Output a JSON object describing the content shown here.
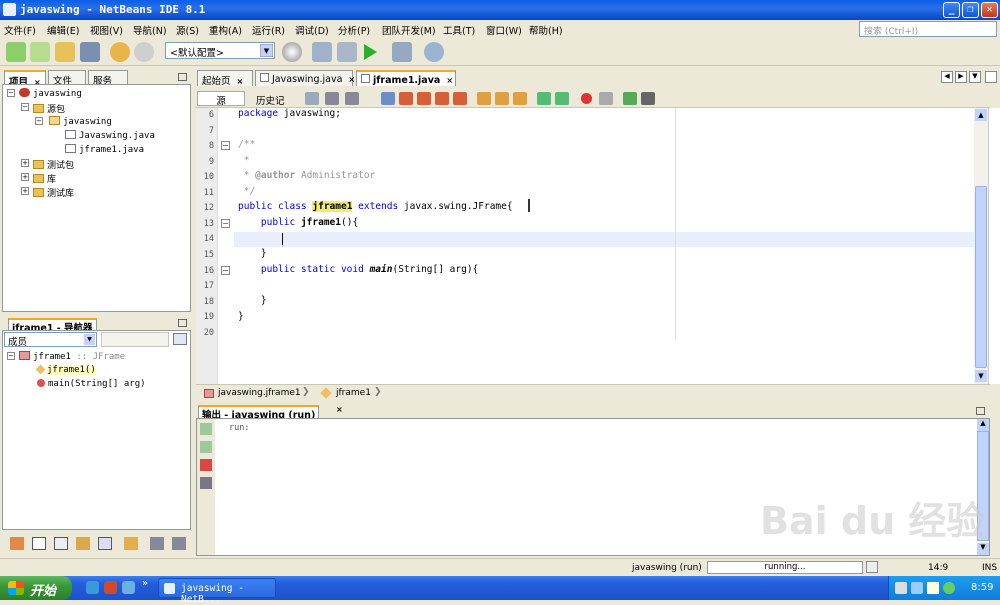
{
  "window": {
    "title": "javaswing - NetBeans IDE 8.1"
  },
  "menu": [
    "文件(F)",
    "编辑(E)",
    "视图(V)",
    "导航(N)",
    "源(S)",
    "重构(A)",
    "运行(R)",
    "调试(D)",
    "分析(P)",
    "团队开发(M)",
    "工具(T)",
    "窗口(W)",
    "帮助(H)"
  ],
  "search": {
    "placeholder": "搜索 (Ctrl+I)"
  },
  "toolbar": {
    "config": "<默认配置>"
  },
  "left_tabs": [
    "项目",
    "文件",
    "服务"
  ],
  "project_tree": {
    "root": "javaswing",
    "source_pkgs": "源包",
    "package": "javaswing",
    "files": [
      "Javaswing.java",
      "jframe1.java"
    ],
    "test_pkgs": "测试包",
    "libs": "库",
    "test_libs": "测试库"
  },
  "navigator": {
    "title": "jframe1 - 导航器",
    "filter": "成员",
    "class": "jframe1",
    "class_type": ":: JFrame",
    "members": [
      "jframe1()",
      "main(String[] arg)"
    ]
  },
  "editor_tabs": [
    "起始页",
    "Javaswing.java",
    "jframe1.java"
  ],
  "editor_subtabs": [
    "源",
    "历史记录"
  ],
  "code_lines": [
    {
      "n": "6",
      "text": "package javaswing;"
    },
    {
      "n": "7",
      "text": ""
    },
    {
      "n": "8",
      "text": "/**"
    },
    {
      "n": "9",
      "text": " *"
    },
    {
      "n": "10",
      "text": " * @author Administrator"
    },
    {
      "n": "11",
      "text": " */"
    },
    {
      "n": "12",
      "text": "public class jframe1 extends javax.swing.JFrame{"
    },
    {
      "n": "13",
      "text": "    public jframe1(){"
    },
    {
      "n": "14",
      "text": ""
    },
    {
      "n": "15",
      "text": "    }"
    },
    {
      "n": "16",
      "text": "    public static void main(String[] arg){"
    },
    {
      "n": "17",
      "text": ""
    },
    {
      "n": "18",
      "text": "    }"
    },
    {
      "n": "19",
      "text": "}"
    },
    {
      "n": "20",
      "text": ""
    }
  ],
  "breadcrumb": [
    "javaswing.jframe1",
    "jframe1"
  ],
  "output": {
    "title": "输出 - javaswing (run)",
    "text": "run:"
  },
  "status": {
    "project": "javaswing (run)",
    "progress": "running...",
    "position": "14:9",
    "mode": "INS"
  },
  "taskbar": {
    "start": "开始",
    "task": "javaswing - NetB...",
    "clock": "8:59"
  },
  "watermark": "Bai du 经验"
}
